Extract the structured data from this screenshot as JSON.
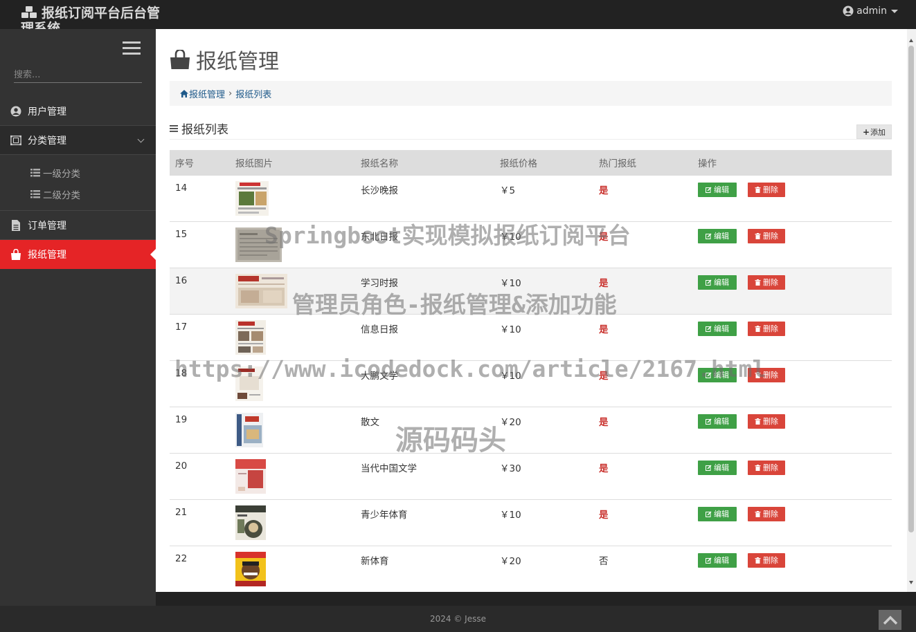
{
  "brand": {
    "title": "报纸订阅平台后台管理系统"
  },
  "user": {
    "name": "admin"
  },
  "sidebar": {
    "search_placeholder": "搜索...",
    "items": [
      {
        "label": "用户管理",
        "icon": "user-circle-icon"
      },
      {
        "label": "分类管理",
        "icon": "category-icon",
        "children": [
          {
            "label": "一级分类",
            "icon": "list-icon"
          },
          {
            "label": "二级分类",
            "icon": "list-icon"
          }
        ]
      },
      {
        "label": "订单管理",
        "icon": "document-icon"
      },
      {
        "label": "报纸管理",
        "icon": "shopping-bag-icon",
        "active": true
      }
    ]
  },
  "page": {
    "title": "报纸管理",
    "breadcrumb": [
      "报纸管理",
      "报纸列表"
    ],
    "section_title": "报纸列表",
    "add_label": "添加"
  },
  "table": {
    "headers": [
      "序号",
      "报纸图片",
      "报纸名称",
      "报纸价格",
      "热门报纸",
      "操作"
    ],
    "edit_label": "编辑",
    "delete_label": "删除",
    "rows": [
      {
        "id": "14",
        "name": "长沙晚报",
        "price": "￥5",
        "hot": "是"
      },
      {
        "id": "15",
        "name": "东北日报",
        "price": "￥10",
        "hot": "是"
      },
      {
        "id": "16",
        "name": "学习时报",
        "price": "￥10",
        "hot": "是"
      },
      {
        "id": "17",
        "name": "信息日报",
        "price": "￥10",
        "hot": "是"
      },
      {
        "id": "18",
        "name": "大鹏文学",
        "price": "￥10",
        "hot": "是"
      },
      {
        "id": "19",
        "name": "散文",
        "price": "￥20",
        "hot": "是"
      },
      {
        "id": "20",
        "name": "当代中国文学",
        "price": "￥30",
        "hot": "是"
      },
      {
        "id": "21",
        "name": "青少年体育",
        "price": "￥10",
        "hot": "是"
      },
      {
        "id": "22",
        "name": "新体育",
        "price": "￥20",
        "hot": "否"
      }
    ]
  },
  "footer": {
    "text": "2024 © Jesse"
  },
  "watermark": {
    "line1": "Springboot实现模拟报纸订阅平台",
    "line2": "管理员角色-报纸管理&添加功能",
    "line3": "https://www.icodedock.com/article/2167.html",
    "line4": "源码码头"
  },
  "colors": {
    "accent": "#e52426",
    "edit": "#3fa046",
    "delete": "#d9453a",
    "hot": "#c9302c"
  }
}
